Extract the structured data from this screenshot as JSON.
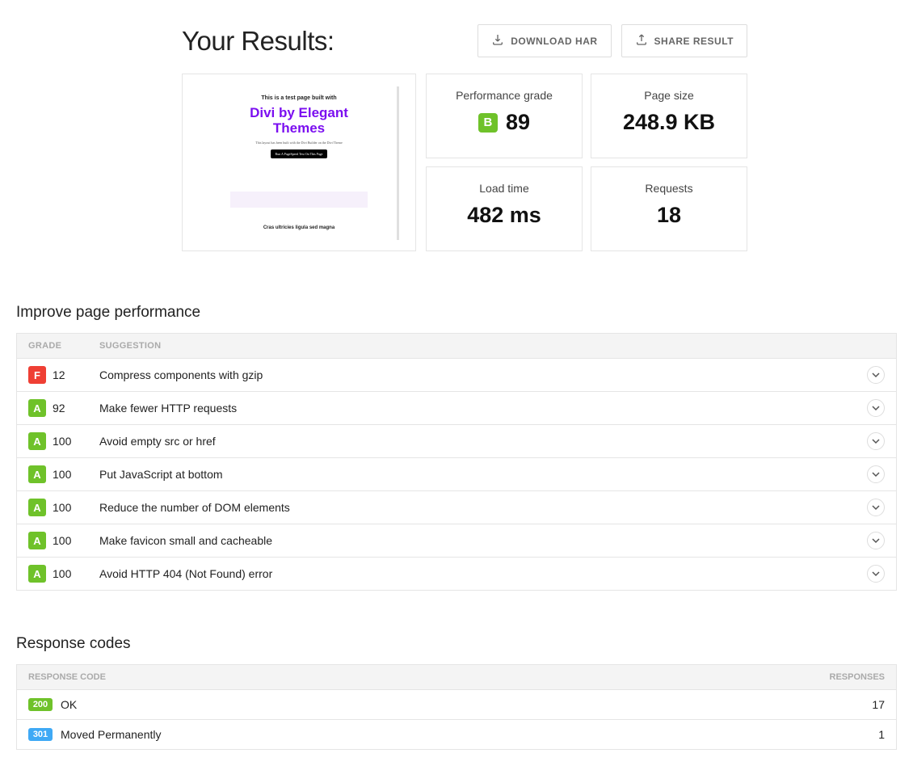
{
  "header": {
    "title": "Your Results:",
    "download_label": "DOWNLOAD HAR",
    "share_label": "SHARE RESULT"
  },
  "preview": {
    "small": "This is a test page built with",
    "title": "Divi by Elegant Themes",
    "sub": "This layout has been built with the Divi Builder on the Divi Theme",
    "badge": "Run A PageSpeed Test On This Page",
    "footer": "Cras ultricies ligula sed magna"
  },
  "metrics": {
    "perf_label": "Performance grade",
    "perf_grade": "B",
    "perf_score": "89",
    "size_label": "Page size",
    "size_value": "248.9 KB",
    "load_label": "Load time",
    "load_value": "482 ms",
    "req_label": "Requests",
    "req_value": "18"
  },
  "improve": {
    "title": "Improve page performance",
    "th_grade": "GRADE",
    "th_sugg": "SUGGESTION",
    "rows": [
      {
        "grade": "F",
        "score": "12",
        "text": "Compress components with gzip"
      },
      {
        "grade": "A",
        "score": "92",
        "text": "Make fewer HTTP requests"
      },
      {
        "grade": "A",
        "score": "100",
        "text": "Avoid empty src or href"
      },
      {
        "grade": "A",
        "score": "100",
        "text": "Put JavaScript at bottom"
      },
      {
        "grade": "A",
        "score": "100",
        "text": "Reduce the number of DOM elements"
      },
      {
        "grade": "A",
        "score": "100",
        "text": "Make favicon small and cacheable"
      },
      {
        "grade": "A",
        "score": "100",
        "text": "Avoid HTTP 404 (Not Found) error"
      }
    ]
  },
  "responses": {
    "title": "Response codes",
    "th_code": "RESPONSE CODE",
    "th_count": "RESPONSES",
    "rows": [
      {
        "code": "200",
        "label": "OK",
        "count": "17"
      },
      {
        "code": "301",
        "label": "Moved Permanently",
        "count": "1"
      }
    ]
  }
}
